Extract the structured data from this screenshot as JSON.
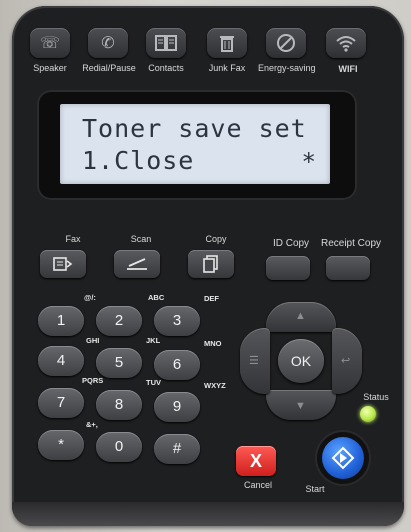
{
  "top_row": {
    "speaker": {
      "label": "Speaker",
      "icon": "phone-icon"
    },
    "redial": {
      "label": "Redial/Pause",
      "icon": "redial-phone-icon"
    },
    "contacts": {
      "label": "Contacts",
      "icon": "book-icon"
    },
    "junk_fax": {
      "label": "Junk Fax",
      "icon": "trash-icon"
    },
    "energy": {
      "label": "Energy-saving",
      "icon": "leaf-icon"
    },
    "wifi": {
      "label": "WIFI",
      "icon": "wifi-icon"
    }
  },
  "lcd": {
    "line1": "Toner save set",
    "line2": "1.Close",
    "marker": "*"
  },
  "functions": {
    "fax": {
      "label": "Fax",
      "icon": "fax-icon"
    },
    "scan": {
      "label": "Scan",
      "icon": "scan-icon"
    },
    "copy": {
      "label": "Copy",
      "icon": "copy-icon"
    },
    "id_copy": {
      "label": "ID Copy"
    },
    "receipt_copy": {
      "label": "Receipt Copy"
    }
  },
  "keypad": {
    "keys": [
      "1",
      "2",
      "3",
      "4",
      "5",
      "6",
      "7",
      "8",
      "9",
      "*",
      "0",
      "#"
    ],
    "hints": {
      "k1": "@/:",
      "k2": "ABC",
      "k3": "DEF",
      "k4": "GHI",
      "k5": "JKL",
      "k6": "MNO",
      "k7": "PQRS",
      "k8": "TUV",
      "k9": "WXYZ",
      "kstar": "&+,"
    }
  },
  "nav": {
    "ok": "OK"
  },
  "status": {
    "label": "Status",
    "color": "#b6e84a"
  },
  "cancel": {
    "label": "Cancel",
    "symbol": "X",
    "color": "#e0322e"
  },
  "start": {
    "label": "Start",
    "color": "#1f5fd6"
  }
}
